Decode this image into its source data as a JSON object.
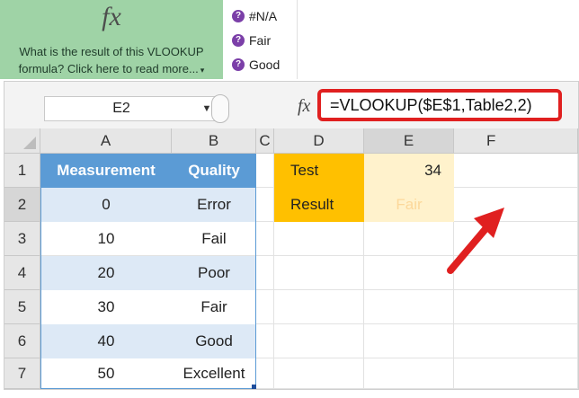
{
  "question": {
    "icon": "fx",
    "text": "What is the result of this VLOOKUP formula? Click here to read more...",
    "caret": "▾"
  },
  "options": [
    "#N/A",
    "Fair",
    "Good"
  ],
  "formula_bar": {
    "name_box": "E2",
    "fx": "fx",
    "formula": "=VLOOKUP($E$1,Table2,2)"
  },
  "columns": [
    "A",
    "B",
    "C",
    "D",
    "E",
    "F"
  ],
  "rows": [
    "1",
    "2",
    "3",
    "4",
    "5",
    "6",
    "7"
  ],
  "table": {
    "headers": [
      "Measurement",
      "Quality"
    ],
    "rows": [
      [
        "0",
        "Error"
      ],
      [
        "10",
        "Fail"
      ],
      [
        "20",
        "Poor"
      ],
      [
        "30",
        "Fair"
      ],
      [
        "40",
        "Good"
      ],
      [
        "50",
        "Excellent"
      ]
    ]
  },
  "lookup": {
    "test_label": "Test",
    "test_value": "34",
    "result_label": "Result",
    "result_value": "Fair"
  },
  "colors": {
    "table_header": "#5b9bd5",
    "table_band": "#dde9f6",
    "label_fill": "#ffc000",
    "value_fill": "#fff2cc",
    "highlight": "#e02020"
  }
}
